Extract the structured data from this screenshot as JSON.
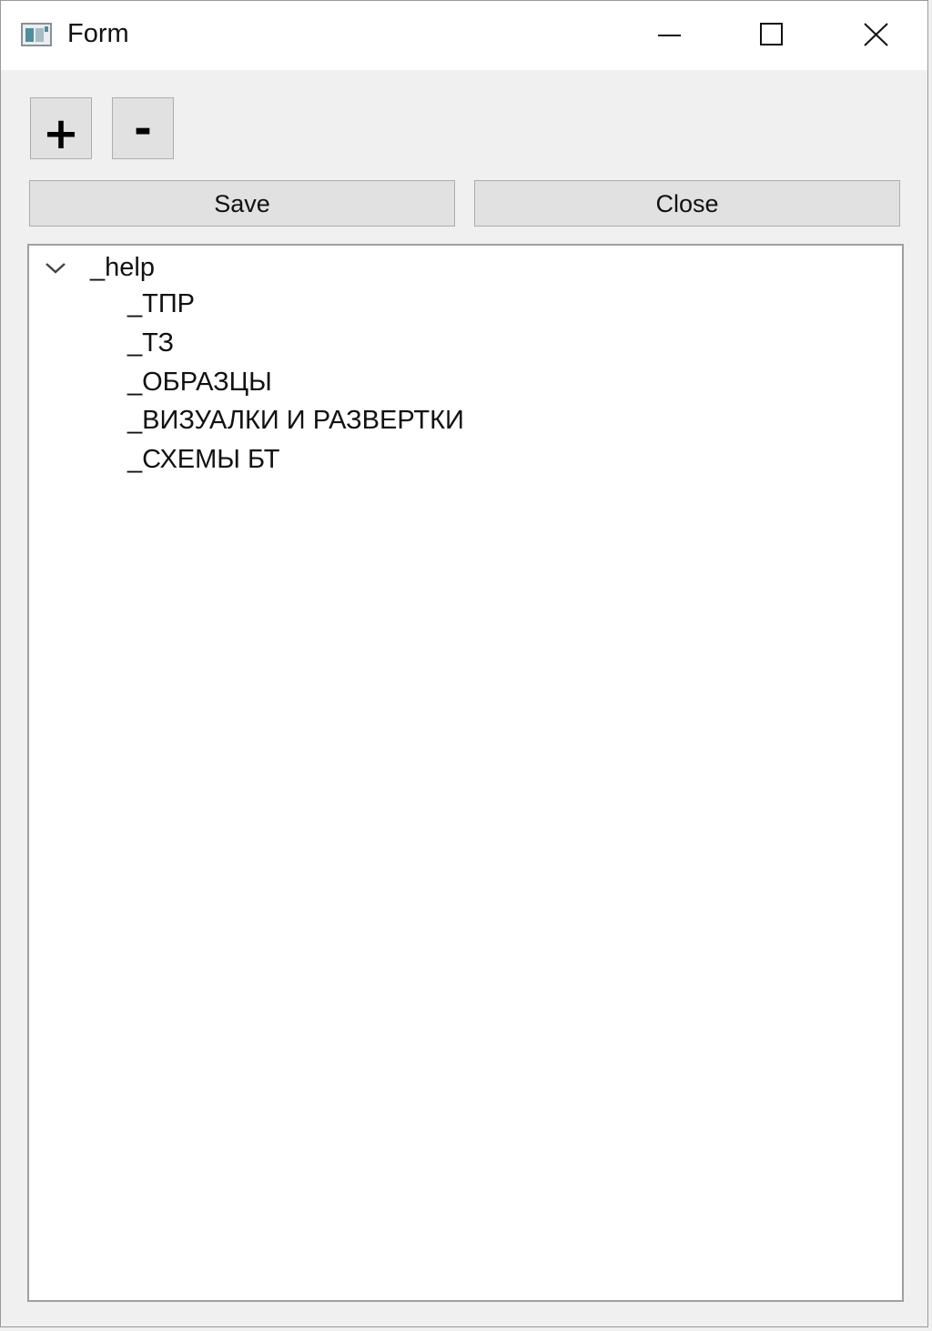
{
  "window": {
    "title": "Form",
    "icon": "app-window-icon",
    "controls": {
      "minimize_icon": "minimize-icon",
      "maximize_icon": "maximize-icon",
      "close_icon": "close-icon"
    }
  },
  "toolbar": {
    "add_label": "+",
    "remove_label": "-"
  },
  "actions": {
    "save_label": "Save",
    "close_label": "Close"
  },
  "tree": {
    "root": {
      "label": "_help",
      "expanded": true,
      "expander_icon": "chevron-down-icon"
    },
    "children": [
      "_ТПР",
      "_ТЗ",
      "_ОБРАЗЦЫ",
      "_ВИЗУАЛКИ И РАЗВЕРТКИ",
      "_СХЕМЫ БТ"
    ]
  },
  "colors": {
    "window_bg": "#f0f0f0",
    "titlebar_bg": "#ffffff",
    "button_bg": "#e1e1e1",
    "button_border": "#adadad",
    "tree_bg": "#ffffff",
    "tree_border": "#a0a0a0"
  }
}
